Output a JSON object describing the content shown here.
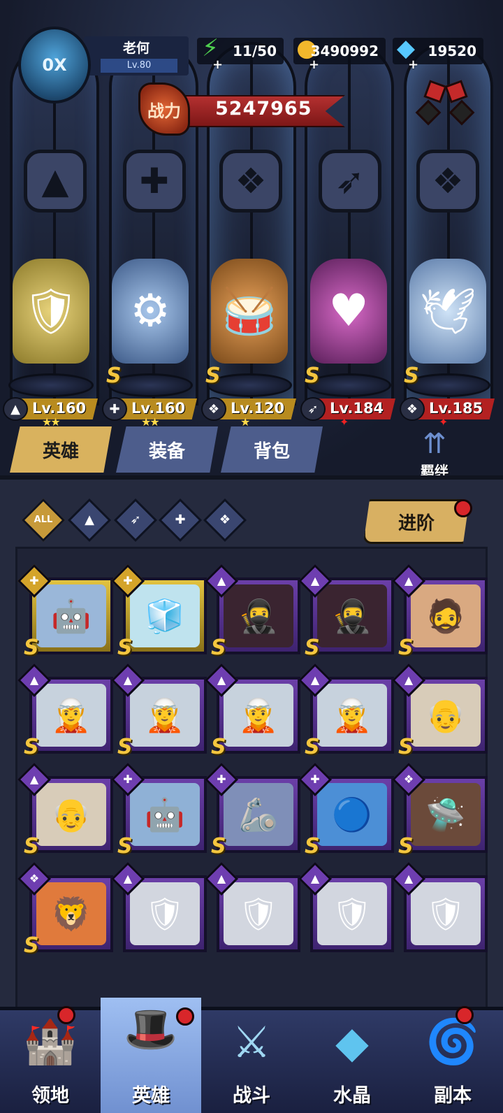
{
  "player": {
    "avatar_text": "0X",
    "name": "老何",
    "level": "Lv.80"
  },
  "resources": {
    "stamina": {
      "icon": "lightning-icon",
      "value": "11/50"
    },
    "gold": {
      "icon": "coin-icon",
      "value": "3490992"
    },
    "diamond": {
      "icon": "diamond-icon",
      "value": "19520"
    }
  },
  "power": {
    "label": "战力",
    "value": "5247965"
  },
  "heroes": [
    {
      "level": "Lv.160",
      "class_icon": "mage-icon",
      "rank": "",
      "stars": "★★",
      "bar_color": "#b88b1f"
    },
    {
      "level": "Lv.160",
      "class_icon": "wrench-icon",
      "rank": "S",
      "stars": "★★",
      "bar_color": "#b88b1f"
    },
    {
      "level": "Lv.120",
      "class_icon": "beast-icon",
      "rank": "S",
      "stars": "★",
      "bar_color": "#b88b1f"
    },
    {
      "level": "Lv.184",
      "class_icon": "wing-icon",
      "rank": "S",
      "stars": "✦",
      "bar_color": "#b32121"
    },
    {
      "level": "Lv.185",
      "class_icon": "beast-icon",
      "rank": "S",
      "stars": "✦",
      "bar_color": "#b32121"
    }
  ],
  "tabs": [
    {
      "label": "英雄",
      "active": true
    },
    {
      "label": "装备",
      "active": false
    },
    {
      "label": "背包",
      "active": false
    }
  ],
  "bond": {
    "label": "羁绊"
  },
  "filters": {
    "all_label": "ALL",
    "icons": [
      "mage-icon",
      "wing-icon",
      "wrench-icon",
      "beast-icon"
    ]
  },
  "advance_button": {
    "label": "进阶"
  },
  "hero_cards": [
    {
      "quality": "yellow",
      "class_icon": "wrench-icon",
      "rank": "S"
    },
    {
      "quality": "yellow",
      "class_icon": "wrench-icon",
      "rank": "S"
    },
    {
      "quality": "purple",
      "class_icon": "mage-icon",
      "rank": "S"
    },
    {
      "quality": "purple",
      "class_icon": "mage-icon",
      "rank": "S"
    },
    {
      "quality": "purple",
      "class_icon": "mage-icon",
      "rank": "S"
    },
    {
      "quality": "purple",
      "class_icon": "mage-icon",
      "rank": "S"
    },
    {
      "quality": "purple",
      "class_icon": "mage-icon",
      "rank": "S"
    },
    {
      "quality": "purple",
      "class_icon": "mage-icon",
      "rank": "S"
    },
    {
      "quality": "purple",
      "class_icon": "mage-icon",
      "rank": "S"
    },
    {
      "quality": "purple",
      "class_icon": "mage-icon",
      "rank": "S"
    },
    {
      "quality": "purple",
      "class_icon": "mage-icon",
      "rank": "S"
    },
    {
      "quality": "purple",
      "class_icon": "wrench-icon",
      "rank": "S"
    },
    {
      "quality": "purple",
      "class_icon": "wrench-icon",
      "rank": "S"
    },
    {
      "quality": "purple",
      "class_icon": "wrench-icon",
      "rank": "S"
    },
    {
      "quality": "purple",
      "class_icon": "beast-icon",
      "rank": "S"
    },
    {
      "quality": "purple",
      "class_icon": "beast-icon",
      "rank": "S"
    },
    {
      "quality": "purple",
      "class_icon": "mage-icon",
      "rank": ""
    },
    {
      "quality": "purple",
      "class_icon": "mage-icon",
      "rank": ""
    },
    {
      "quality": "purple",
      "class_icon": "mage-icon",
      "rank": ""
    },
    {
      "quality": "purple",
      "class_icon": "mage-icon",
      "rank": ""
    }
  ],
  "nav": [
    {
      "label": "领地",
      "icon": "castle-icon",
      "active": false,
      "badge": true
    },
    {
      "label": "英雄",
      "icon": "wizard-hat-icon",
      "active": true,
      "badge": true
    },
    {
      "label": "战斗",
      "icon": "sword-icon",
      "active": false,
      "badge": false
    },
    {
      "label": "水晶",
      "icon": "crystal-icon",
      "active": false,
      "badge": false
    },
    {
      "label": "副本",
      "icon": "portal-icon",
      "active": false,
      "badge": true
    }
  ],
  "colors": {
    "gold_accent": "#d9b25e",
    "tab_inactive": "#4d5d8c",
    "power_red": "#b43030",
    "rank_yellow": "#f4c63f",
    "card_purple": "#6b3fa8",
    "card_yellow": "#e2c340"
  }
}
